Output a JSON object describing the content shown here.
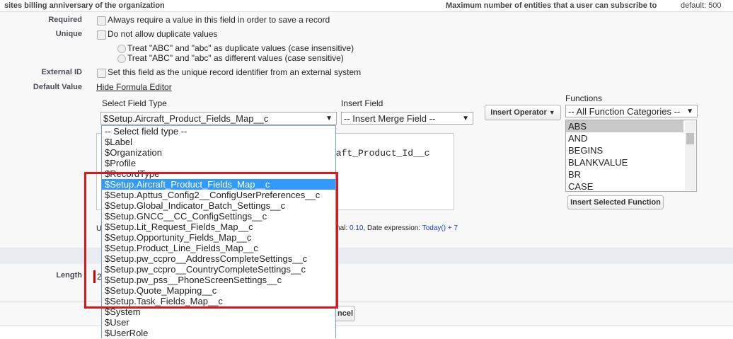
{
  "top_strip": {
    "left": "sites billing anniversary of the organization",
    "right": "Maximum number of entities that a user can subscribe to",
    "default": "default: 500"
  },
  "form": {
    "required": {
      "label": "Required",
      "text": "Always require a value in this field in order to save a record"
    },
    "unique": {
      "label": "Unique",
      "text": "Do not allow duplicate values",
      "options": [
        "Treat \"ABC\" and \"abc\" as duplicate values (case insensitive)",
        "Treat \"ABC\" and \"abc\" as different values (case sensitive)"
      ]
    },
    "external_id": {
      "label": "External ID",
      "text": "Set this field as the unique record identifier from an external system"
    },
    "default_value": {
      "label": "Default Value",
      "link": "Hide Formula Editor"
    },
    "length": {
      "label": "Length",
      "value": "2"
    }
  },
  "editor": {
    "select_field_type_label": "Select Field Type",
    "select_field_type_value": "$Setup.Aircraft_Product_Fields_Map__c",
    "insert_field_label": "Insert Field",
    "insert_field_value": "-- Insert Merge Field --",
    "insert_operator": "Insert Operator",
    "functions_label": "Functions",
    "functions_category": "-- All Function Categories --",
    "functions": [
      "ABS",
      "AND",
      "BEGINS",
      "BLANKVALUE",
      "BR",
      "CASE"
    ],
    "insert_function": "Insert Selected Function",
    "formula_text": "raft_Product_Id__c",
    "hint_prefix": "U",
    "hint_decimal_label": "decimal:",
    "hint_decimal": "0.10",
    "hint_date_label": ", Date expression:",
    "hint_date": "Today() + 7",
    "cancel_fragment": "ncel"
  },
  "dropdown": {
    "selected_index": 5,
    "options": [
      "-- Select field type --",
      "$Label",
      "$Organization",
      "$Profile",
      "$RecordType",
      "$Setup.Aircraft_Product_Fields_Map__c",
      "$Setup.Apttus_Config2__ConfigUserPreferences__c",
      "$Setup.Global_Indicator_Batch_Settings__c",
      "$Setup.GNCC__CC_ConfigSettings__c",
      "$Setup.Lit_Request_Fields_Map__c",
      "$Setup.Opportunity_Fields_Map__c",
      "$Setup.Product_Line_Fields_Map__c",
      "$Setup.pw_ccpro__AddressCompleteSettings__c",
      "$Setup.pw_ccpro__CountryCompleteSettings__c",
      "$Setup.pw_pss__PhoneScreenSettings__c",
      "$Setup.Quote_Mapping__c",
      "$Setup.Task_Fields_Map__c",
      "$System",
      "$User",
      "$UserRole"
    ]
  },
  "colors": {
    "highlight": "#3399ff",
    "annotation": "#e0141b",
    "link": "#1a3fbf"
  }
}
